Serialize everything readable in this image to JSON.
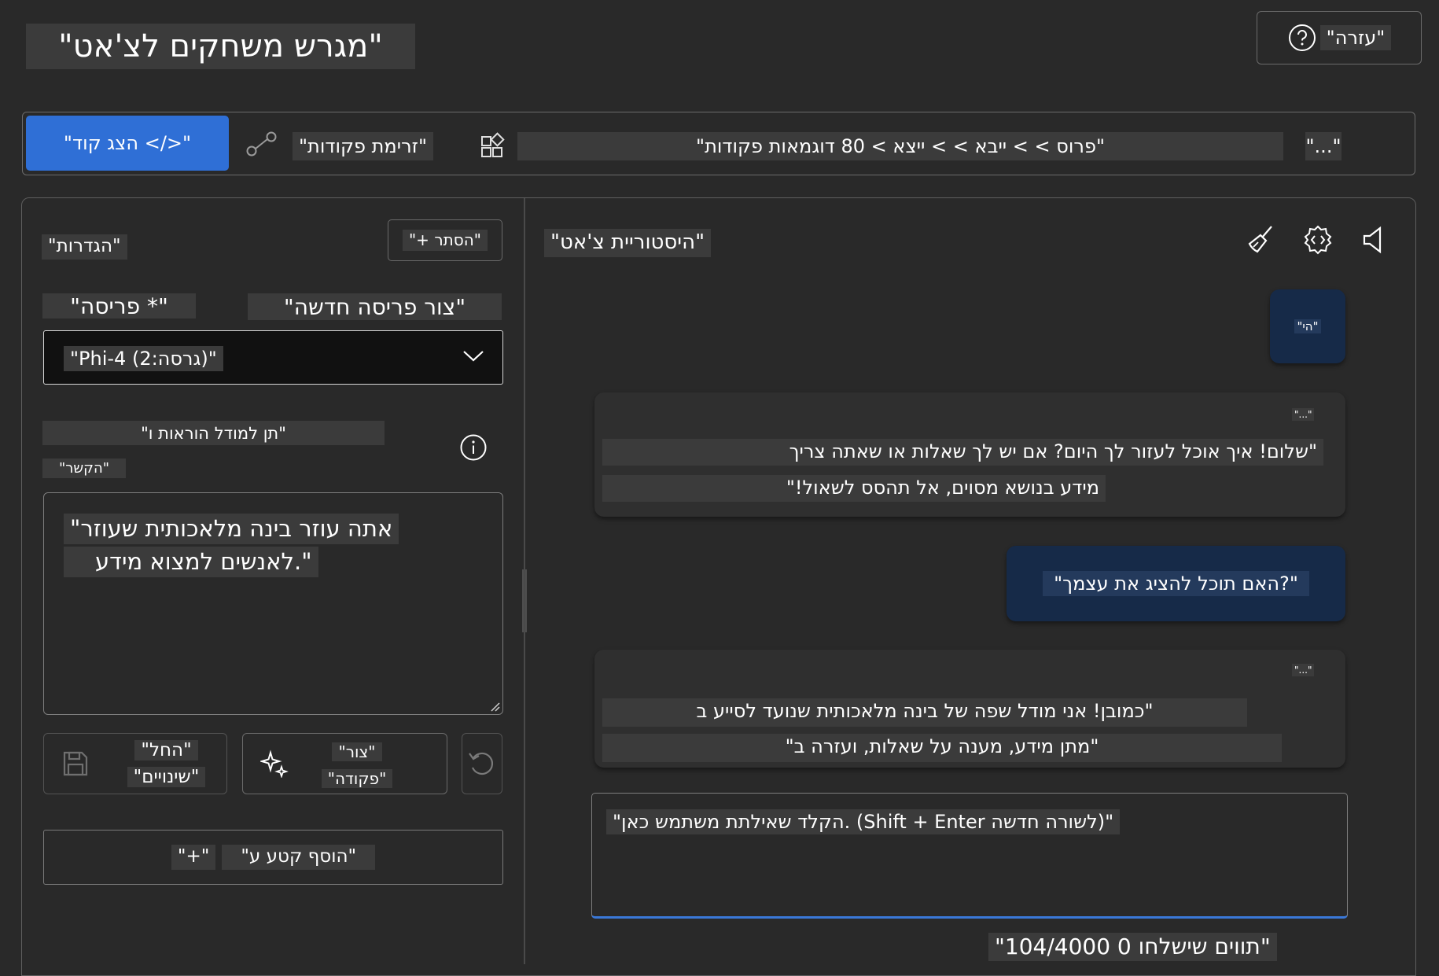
{
  "header": {
    "title": "\"מגרש משחקים לצ'אט\"",
    "help_label": "\"עזרה\"",
    "help_icon": "question-circle-icon"
  },
  "toolbar": {
    "view_code_label": "\"הצג קוד </>\"",
    "command_flow_label": "\"זרימת פקודות\"",
    "breadcrumb": "\"פרוס > > ייבא > > ייצא > 80 דוגמאות פקודות\"",
    "more_label": "\"...\""
  },
  "settings": {
    "title": "\"הגדרות\"",
    "hide_label": "\"+ הסתר\"",
    "persona_label": "\"פריסה *\"",
    "new_persona_label": "\"צור פריסה חדשה\"",
    "model_value": "\"Phi-4 (גרסה:2)\"",
    "instructions_label_line1": "\"תן למודל הוראות ו\"",
    "instructions_label_line2": "\"הקשר\"",
    "system_prompt_line1": "\"אתה עוזר בינה מלאכותית שעוזר",
    "system_prompt_line2": "לאנשים למצוא מידע.\"",
    "save_label_line1": "\"החל\"",
    "save_label_line2": "\"שינויים\"",
    "generate_label_line1": "\"צור\"",
    "generate_label_line2": "\"פקודה\"",
    "add_snippet_label": "\"הוסף קטע ע\"",
    "add_snippet_plus": "\"+\""
  },
  "chat": {
    "title": "\"היסטוריית צ'אט\"",
    "messages": [
      {
        "role": "user",
        "lines": [
          "\"הי\""
        ]
      },
      {
        "role": "assistant",
        "header": "\"...\"",
        "lines": [
          "\"שלום! איך אוכל לעזור לך היום? אם יש לך שאלות או שאתה צריך",
          "מידע בנושא מסוים, אל תהסס לשאול!\""
        ]
      },
      {
        "role": "user",
        "lines": [
          "\"האם תוכל להציג את עצמך?\""
        ]
      },
      {
        "role": "assistant",
        "header": "\"...\"",
        "lines": [
          "\"כמובן! אני מודל שפה של בינה מלאכותית שנועד לסייע ב",
          "\"מתן מידע, מענה על שאלות, ועזרה ב\""
        ]
      }
    ],
    "input_placeholder": "\"הקלד שאילתת משתמש כאן. (Shift + Enter לשורה חדשה)\"",
    "char_counter": "\"104/4000 תווים שישלחו 0\""
  },
  "colors": {
    "background": "#292929",
    "accent": "#2f6fd6",
    "user_bubble": "#162a48",
    "assistant_bubble": "#2f2f2f"
  }
}
